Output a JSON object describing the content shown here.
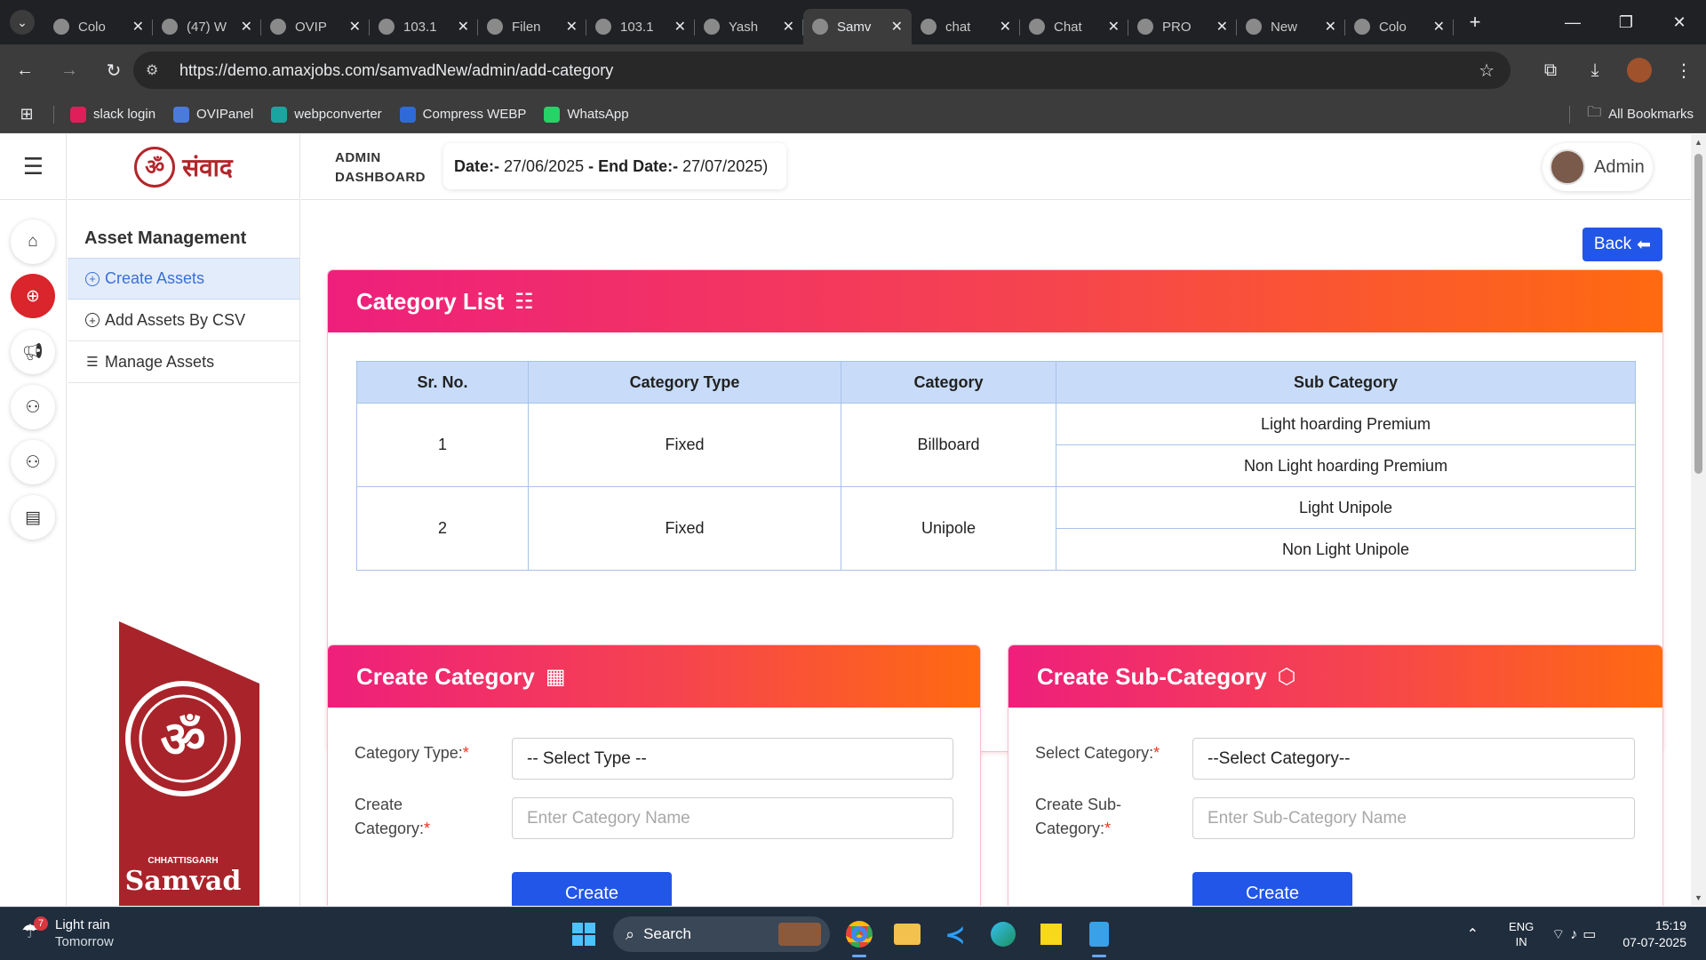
{
  "browser": {
    "tabs": [
      {
        "title": "Colo",
        "icon": "app-icon",
        "active": false
      },
      {
        "title": "(47) W",
        "icon": "whatsapp-icon",
        "active": false
      },
      {
        "title": "OVIP",
        "icon": "ovi-icon",
        "active": false
      },
      {
        "title": "103.1",
        "icon": "vlc-icon",
        "active": false
      },
      {
        "title": "Filen",
        "icon": "folder-icon",
        "active": false
      },
      {
        "title": "103.1",
        "icon": "globe-icon",
        "active": false
      },
      {
        "title": "Yash",
        "icon": "note-icon",
        "active": false
      },
      {
        "title": "Samv",
        "icon": "samvad-icon",
        "active": true
      },
      {
        "title": "chat",
        "icon": "yahoo-icon",
        "active": false
      },
      {
        "title": "Chat",
        "icon": "chatgpt-icon",
        "active": false
      },
      {
        "title": "PRO",
        "icon": "chatgpt-icon",
        "active": false
      },
      {
        "title": "New",
        "icon": "globe-icon",
        "active": false
      },
      {
        "title": "Colo",
        "icon": "app-icon",
        "active": false
      }
    ],
    "url": "https://demo.amaxjobs.com/samvadNew/admin/add-category",
    "bookmarks": [
      {
        "label": "slack login",
        "icon": "slack-icon",
        "color": "#e01e5a"
      },
      {
        "label": "OVIPanel",
        "icon": "ovi-icon",
        "color": "#4a7bd8"
      },
      {
        "label": "webpconverter",
        "icon": "webp-icon",
        "color": "#1aa6a0"
      },
      {
        "label": "Compress WEBP",
        "icon": "compress-icon",
        "color": "#2f6bd8"
      },
      {
        "label": "WhatsApp",
        "icon": "whatsapp-icon",
        "color": "#25d366"
      }
    ],
    "all_bookmarks": "All Bookmarks"
  },
  "header": {
    "dashboard_line1": "ADMIN",
    "dashboard_line2": "DASHBOARD",
    "date_prefix": "Date:- ",
    "start_date": "27/06/2025",
    "separator": " - ",
    "end_label": "End Date:- ",
    "end_date": "27/07/2025)",
    "admin_name": "Admin"
  },
  "logo": {
    "hindi_text": "संवाद",
    "brand_sub": "CHHATTISGARH",
    "brand": "Samvad"
  },
  "sidebar": {
    "title": "Asset Management",
    "items": [
      {
        "label": "Create Assets",
        "icon": "plus-circle-icon",
        "active": true
      },
      {
        "label": "Add Assets By CSV",
        "icon": "plus-circle-icon",
        "active": false
      },
      {
        "label": "Manage Assets",
        "icon": "list-icon",
        "active": false
      }
    ]
  },
  "back_button": "Back",
  "category_list": {
    "title": "Category List",
    "columns": [
      "Sr. No.",
      "Category Type",
      "Category",
      "Sub Category"
    ],
    "rows": [
      {
        "sr": "1",
        "type": "Fixed",
        "category": "Billboard",
        "subs": [
          "Light hoarding Premium",
          "Non Light hoarding Premium"
        ]
      },
      {
        "sr": "2",
        "type": "Fixed",
        "category": "Unipole",
        "subs": [
          "Light Unipole",
          "Non Light Unipole"
        ]
      }
    ]
  },
  "create_category": {
    "title": "Create Category",
    "type_label": "Category Type:",
    "type_value": "-- Select Type --",
    "name_label_1": "Create",
    "name_label_2": "Category:",
    "name_placeholder": "Enter Category Name",
    "button": "Create"
  },
  "create_subcategory": {
    "title": "Create Sub-Category",
    "cat_label": "Select Category:",
    "cat_value": "--Select Category--",
    "name_label_1": "Create Sub-",
    "name_label_2": "Category:",
    "name_placeholder": "Enter Sub-Category Name",
    "button": "Create"
  },
  "taskbar": {
    "weather_badge": "7",
    "weather_line1": "Light rain",
    "weather_line2": "Tomorrow",
    "search": "Search",
    "lang1": "ENG",
    "lang2": "IN",
    "time": "15:19",
    "date": "07-07-2025"
  }
}
